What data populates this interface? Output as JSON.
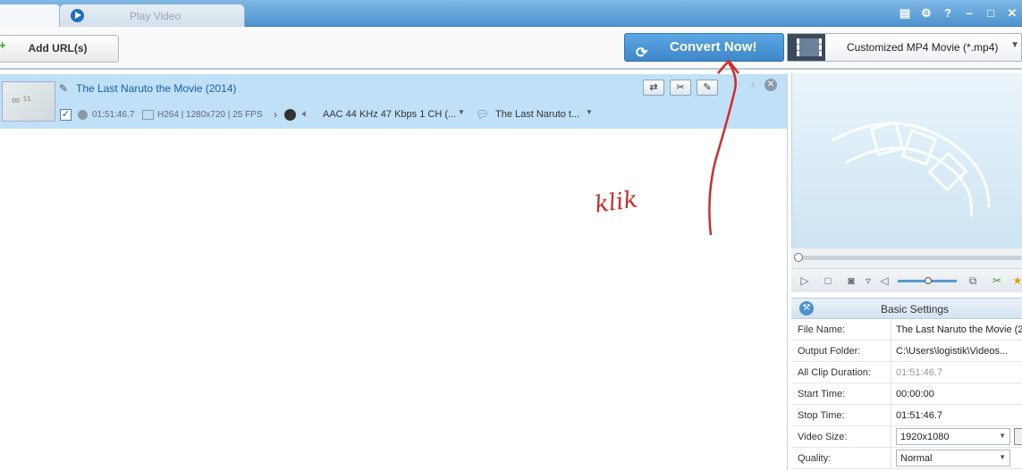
{
  "tabs": {
    "play_video": "Play Video"
  },
  "window_buttons": [
    "▤",
    "⚙",
    "?",
    "–",
    "□",
    "✕"
  ],
  "toolbar": {
    "add_url_label": "Add URL(s)",
    "convert_label": "Convert Now!",
    "profile_label": "Customized MP4 Movie (*.mp4)"
  },
  "file": {
    "title": "The Last Naruto the Movie (2014)",
    "duration": "01:51:46.7",
    "video_info": "H264 | 1280x720 | 25 FPS",
    "audio": "AAC 44 KHz 47 Kbps 1 CH (...",
    "subtitle": "The Last Naruto t..."
  },
  "settings": {
    "header": "Basic Settings",
    "rows": [
      {
        "label": "File Name:",
        "value": "The Last Naruto the Movie (2"
      },
      {
        "label": "Output Folder:",
        "value": "C:\\Users\\logistik\\Videos..."
      },
      {
        "label": "All Clip Duration:",
        "value": "01:51:46.7"
      },
      {
        "label": "Start Time:",
        "value": "00:00:00"
      },
      {
        "label": "Stop Time:",
        "value": "01:51:46.7"
      },
      {
        "label": "Video Size:",
        "value": "1920x1080"
      },
      {
        "label": "Quality:",
        "value": "Normal"
      }
    ]
  },
  "annotation": {
    "text": "klik",
    "color": "#d42a2a"
  }
}
